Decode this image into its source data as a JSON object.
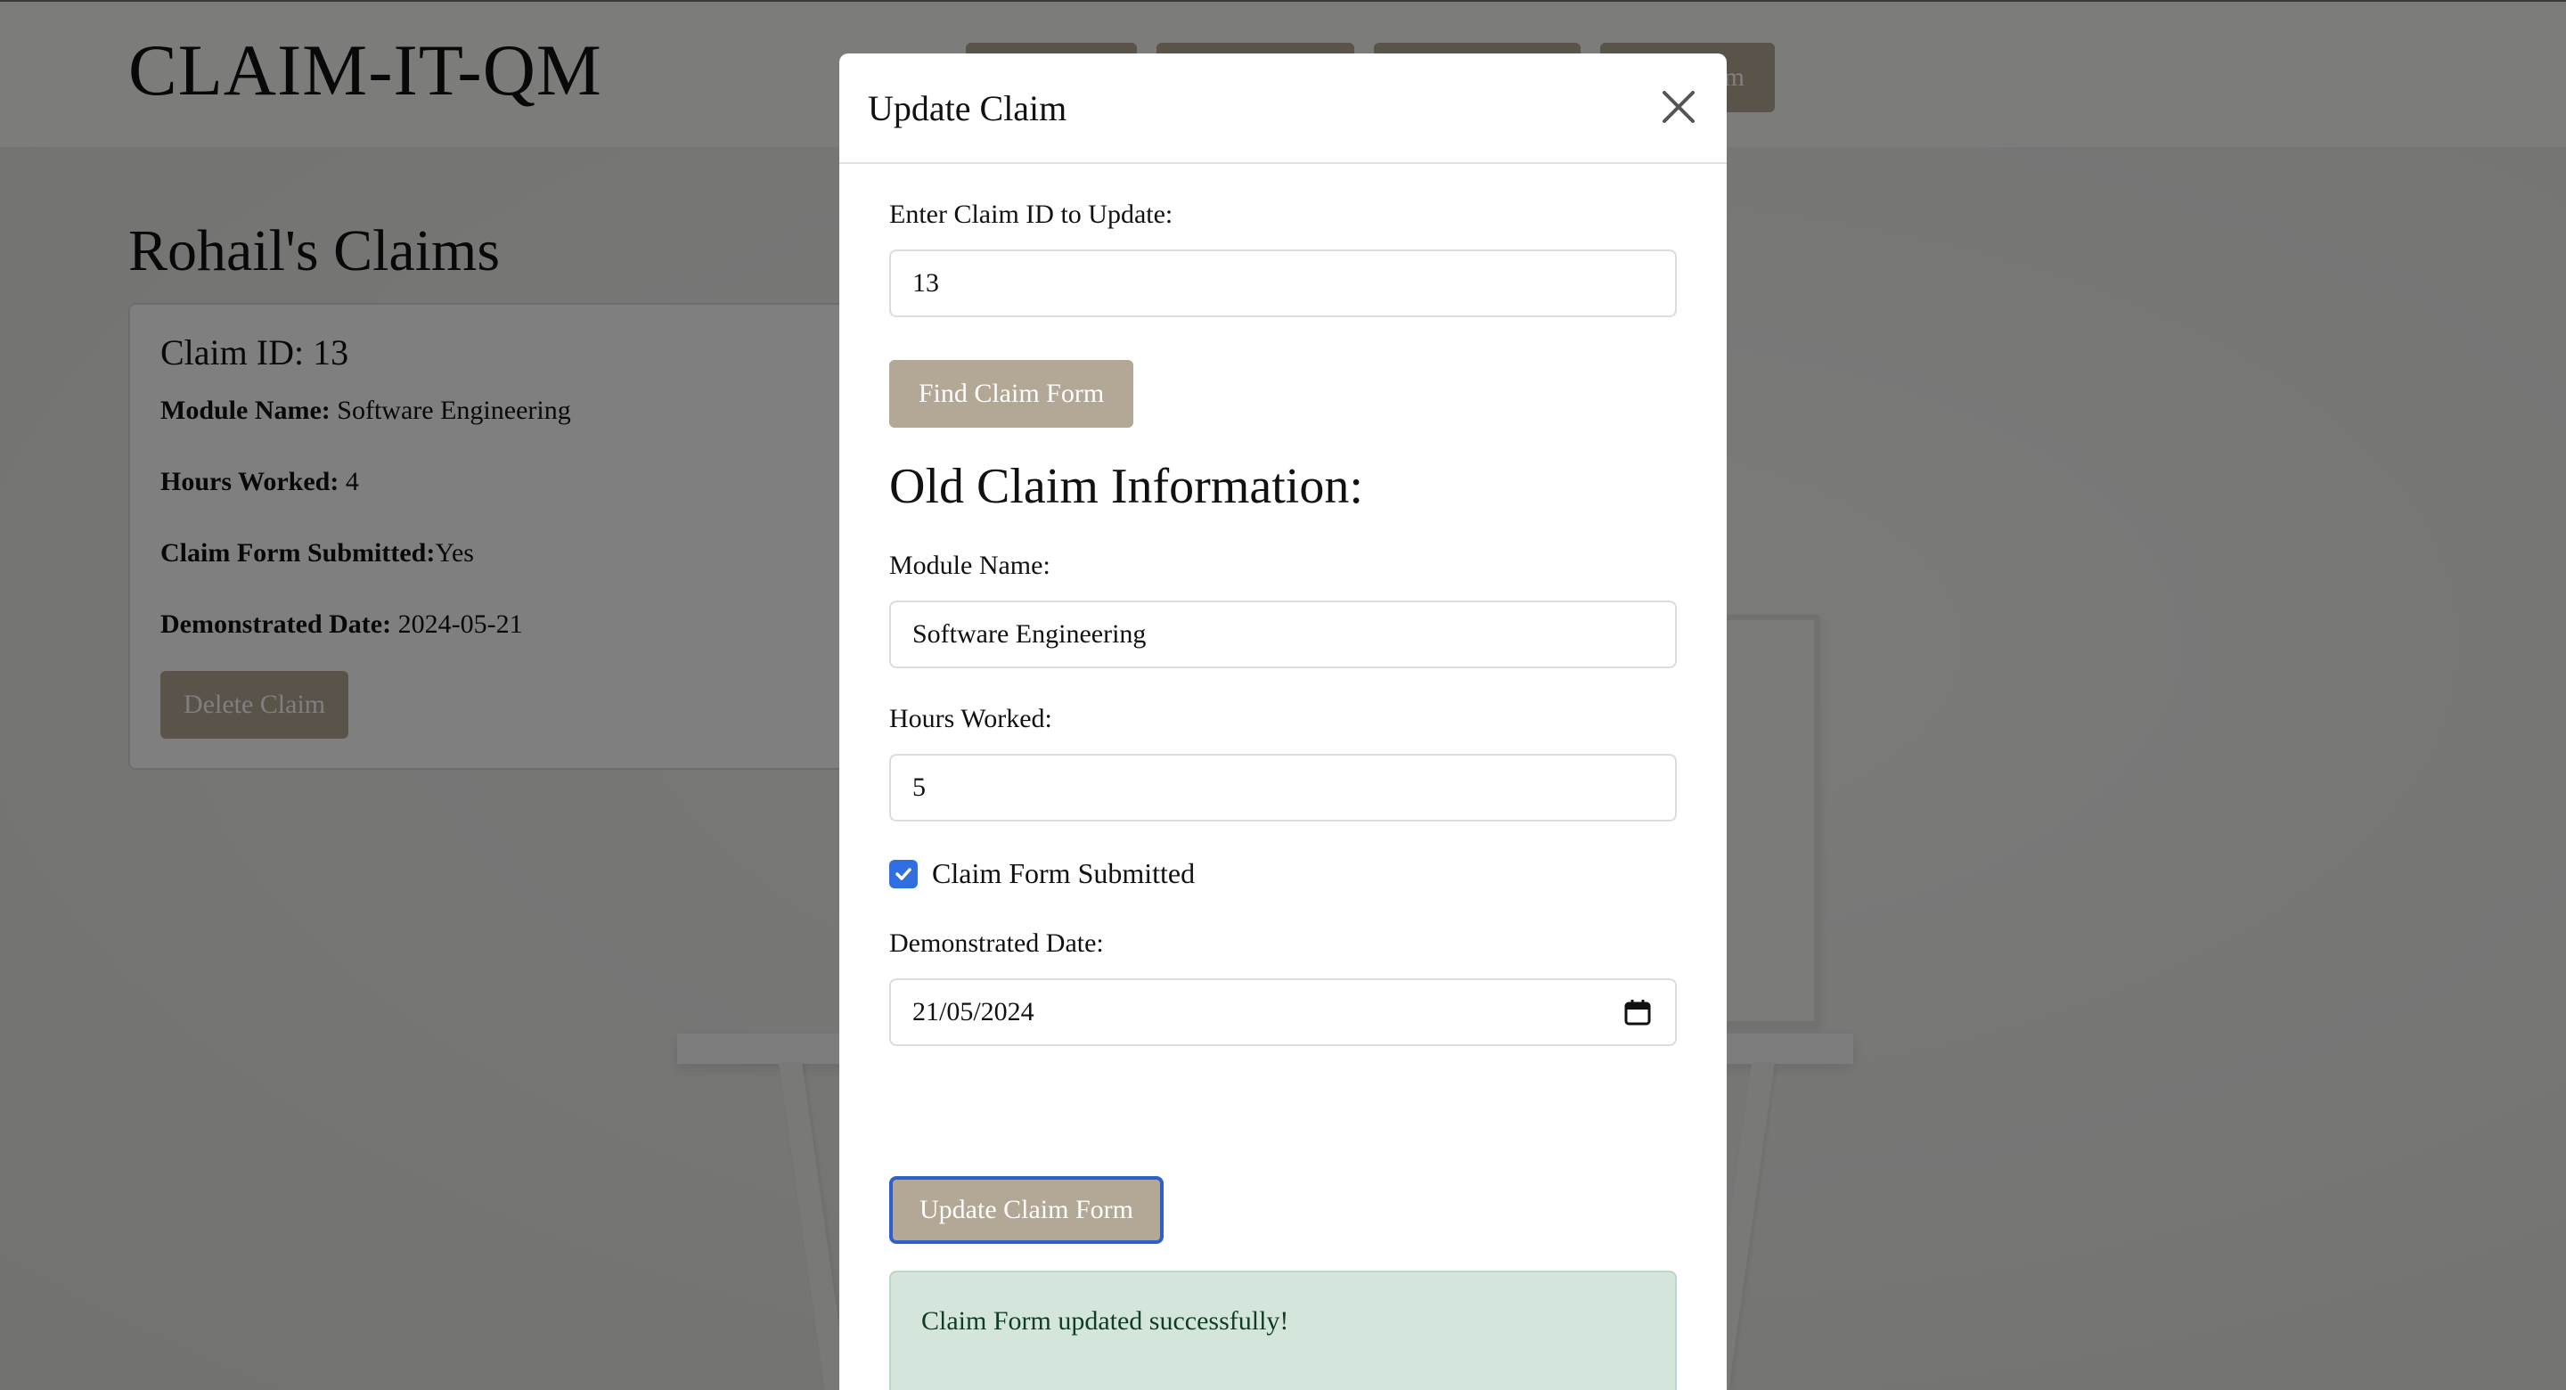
{
  "header": {
    "brand": "CLAIM-IT-QM",
    "nav": [
      {
        "label": ""
      },
      {
        "label": ""
      },
      {
        "label": ""
      },
      {
        "label": "m"
      }
    ]
  },
  "main": {
    "section_title": "Rohail's Claims",
    "claim_card": {
      "title": "Claim ID: 13",
      "module_label": "Module Name:",
      "module_value": " Software Engineering",
      "hours_label": "Hours Worked:",
      "hours_value": " 4",
      "submitted_label": "Claim Form Submitted:",
      "submitted_value": "Yes",
      "date_label": "Demonstrated Date:",
      "date_value": " 2024-05-21",
      "delete_label": "Delete Claim"
    }
  },
  "modal": {
    "title": "Update Claim",
    "claim_id_label": "Enter Claim ID to Update:",
    "claim_id_value": "13",
    "find_label": "Find Claim Form",
    "old_info_title": "Old Claim Information:",
    "module_label": "Module Name:",
    "module_value": "Software Engineering",
    "hours_label": "Hours Worked:",
    "hours_value": "5",
    "submitted_label": "Claim Form Submitted",
    "submitted_checked": true,
    "date_label": "Demonstrated Date:",
    "date_value": "21/05/2024",
    "update_label": "Update Claim Form",
    "success_message": "Claim Form updated successfully!"
  },
  "colors": {
    "accent": "#b3a795",
    "checkbox": "#2f6fe0",
    "alert_bg": "#d4e6dc"
  }
}
